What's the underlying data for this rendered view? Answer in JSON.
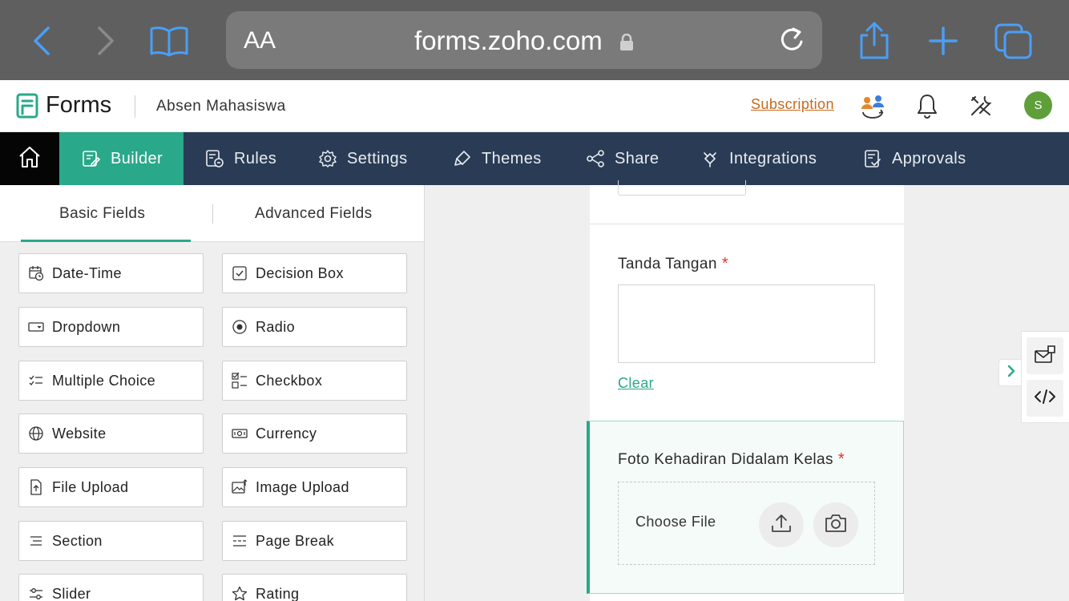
{
  "browser": {
    "text_size_label": "AA",
    "url": "forms.zoho.com",
    "icons": [
      "back-icon",
      "forward-icon",
      "bookmarks-icon",
      "lock-icon",
      "reload-icon",
      "share-icon",
      "new-tab-icon",
      "tabs-icon"
    ]
  },
  "header": {
    "app_name": "Forms",
    "form_name": "Absen Mahasiswa",
    "subscription_label": "Subscription",
    "avatar_initial": "S",
    "icons": [
      "forms-logo-icon",
      "users-sync-icon",
      "bell-icon",
      "tools-icon"
    ]
  },
  "nav": {
    "items": [
      {
        "label": "Builder",
        "icon": "builder-icon",
        "active": true
      },
      {
        "label": "Rules",
        "icon": "rules-icon"
      },
      {
        "label": "Settings",
        "icon": "gear-icon"
      },
      {
        "label": "Themes",
        "icon": "brush-icon"
      },
      {
        "label": "Share",
        "icon": "share-icon"
      },
      {
        "label": "Integrations",
        "icon": "plug-icon"
      },
      {
        "label": "Approvals",
        "icon": "approvals-icon"
      }
    ]
  },
  "fields_panel": {
    "tabs": [
      {
        "label": "Basic Fields",
        "active": true
      },
      {
        "label": "Advanced Fields"
      }
    ],
    "fields": [
      {
        "label": "Date-Time",
        "icon": "calendar-clock-icon"
      },
      {
        "label": "Decision Box",
        "icon": "checkbox-checked-icon"
      },
      {
        "label": "Dropdown",
        "icon": "dropdown-icon"
      },
      {
        "label": "Radio",
        "icon": "radio-icon"
      },
      {
        "label": "Multiple Choice",
        "icon": "multiple-choice-icon"
      },
      {
        "label": "Checkbox",
        "icon": "checklist-icon"
      },
      {
        "label": "Website",
        "icon": "globe-icon"
      },
      {
        "label": "Currency",
        "icon": "banknote-icon"
      },
      {
        "label": "File Upload",
        "icon": "file-upload-icon"
      },
      {
        "label": "Image Upload",
        "icon": "image-upload-icon"
      },
      {
        "label": "Section",
        "icon": "section-icon"
      },
      {
        "label": "Page Break",
        "icon": "page-break-icon"
      },
      {
        "label": "Slider",
        "icon": "slider-icon"
      },
      {
        "label": "Rating",
        "icon": "star-icon"
      }
    ]
  },
  "form": {
    "signature": {
      "label": "Tanda Tangan",
      "required_mark": "*",
      "clear_label": "Clear"
    },
    "photo": {
      "label": "Foto Kehadiran Didalam Kelas",
      "required_mark": "*",
      "choose_file_label": "Choose File",
      "icons": [
        "upload-icon",
        "camera-icon"
      ]
    }
  },
  "side_toolbar": {
    "icons": [
      "chevron-right-icon",
      "theme-icon",
      "code-icon"
    ]
  },
  "colors": {
    "accent": "#2aa88a",
    "nav_bg": "#2a3c55",
    "safari_bar": "#5f5f5f",
    "link": "#2aa88a",
    "subscription": "#c76b1e",
    "required": "#e0342b",
    "avatar": "#5f9f3a"
  }
}
